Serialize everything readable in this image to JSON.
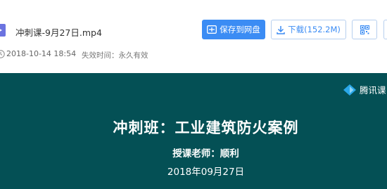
{
  "file": {
    "name": "冲刺课-9月27日.mp4",
    "icon": "video-file-icon"
  },
  "toolbar": {
    "save_label": "保存到网盘",
    "download_label": "下载(152.2M)",
    "qr_icon": "qr-code-icon",
    "accent_color": "#3b8cf4"
  },
  "meta": {
    "date": "2018-10-14 18:54",
    "expire": "失效时间：永久有效"
  },
  "preview": {
    "background_color": "#045055",
    "brand": "腾讯课",
    "title": "冲刺班：工业建筑防火案例",
    "teacher": "授课老师：顺利",
    "date": "2018年09月27日"
  }
}
